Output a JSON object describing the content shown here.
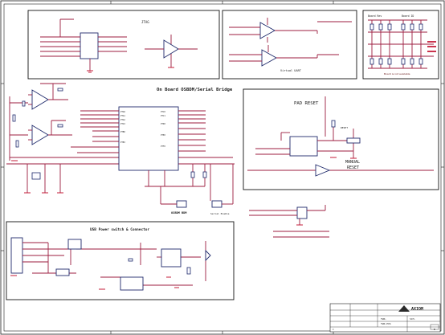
{
  "sheet": {
    "bridge_title": "On Board OSBDM/Serial Bridge",
    "usb_title": "USB Power switch & Connector",
    "pad_reset": "PAD RESET",
    "manual_reset": "MANUAL\nRESET",
    "jtag_title": "JTAG",
    "virtual_uart": "Virtual UART",
    "board_misc": "Board is not available",
    "board_box_left": "Board Rev",
    "board_box_right": "Board ID",
    "osbdm_label": "OSBDM BDM",
    "serial_enable": "Serial Enable",
    "reset_net": "RESET",
    "manual_label": "MANUAL",
    "reset_label": "RESET"
  },
  "title_block": {
    "company": "AXIOM",
    "row1": "TWR-",
    "row2": "SCH-",
    "doc_title": "TWR-POS",
    "sheet_size": "C",
    "rev": "B"
  }
}
